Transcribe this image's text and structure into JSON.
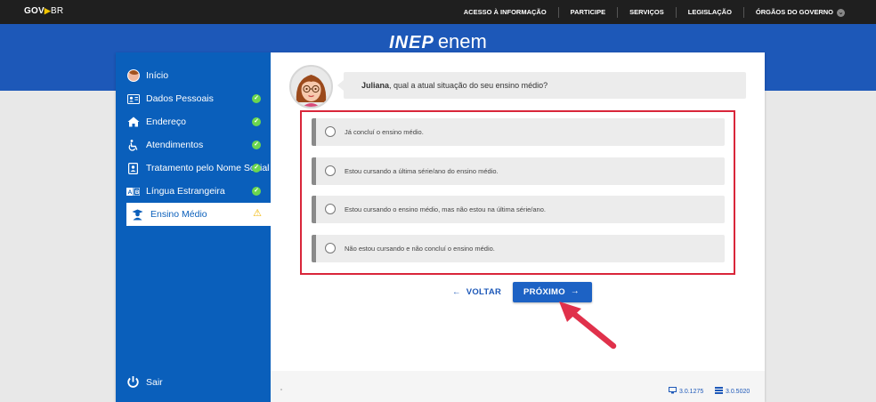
{
  "govbar": {
    "logo_gov": "GOV",
    "logo_arrow": "▶",
    "logo_br": "BR",
    "nav": [
      "ACESSO À INFORMAÇÃO",
      "PARTICIPE",
      "SERVIÇOS",
      "LEGISLAÇÃO",
      "ÓRGÃOS DO GOVERNO"
    ],
    "chevron": "⌄"
  },
  "brand": {
    "inep": "INEP",
    "enem": "enem"
  },
  "sidebar": {
    "items": [
      {
        "label": "Início",
        "icon": "avatar-icon",
        "status": "none"
      },
      {
        "label": "Dados Pessoais",
        "icon": "id-card-icon",
        "status": "done"
      },
      {
        "label": "Endereço",
        "icon": "home-icon",
        "status": "done"
      },
      {
        "label": "Atendimentos",
        "icon": "wheelchair-icon",
        "status": "done"
      },
      {
        "label": "Tratamento pelo Nome Social",
        "icon": "badge-icon",
        "status": "done"
      },
      {
        "label": "Língua Estrangeira",
        "icon": "language-icon",
        "status": "done"
      },
      {
        "label": "Ensino Médio",
        "icon": "graduate-icon",
        "status": "warning"
      }
    ],
    "check_glyph": "✓",
    "warn_glyph": "⚠",
    "logout_label": "Sair"
  },
  "question": {
    "name": "Juliana",
    "text": ", qual a atual situação do seu ensino médio?"
  },
  "options": [
    "Já concluí o ensino médio.",
    "Estou cursando a última série/ano do ensino médio.",
    "Estou cursando o ensino médio, mas não estou na última série/ano.",
    "Não estou cursando e não concluí o ensino médio."
  ],
  "buttons": {
    "back_arrow": "←",
    "back_label": "VOLTAR",
    "next_label": "PRÓXIMO",
    "next_arrow": "→"
  },
  "footer": {
    "version_front": "3.0.1275",
    "version_back": "3.0.5020"
  },
  "colors": {
    "header_blue": "#1d58b8",
    "sidebar_blue": "#0a5fbb",
    "highlight_red": "#d9263a",
    "check_green": "#6bd64f",
    "warn_yellow": "#f2b600"
  }
}
